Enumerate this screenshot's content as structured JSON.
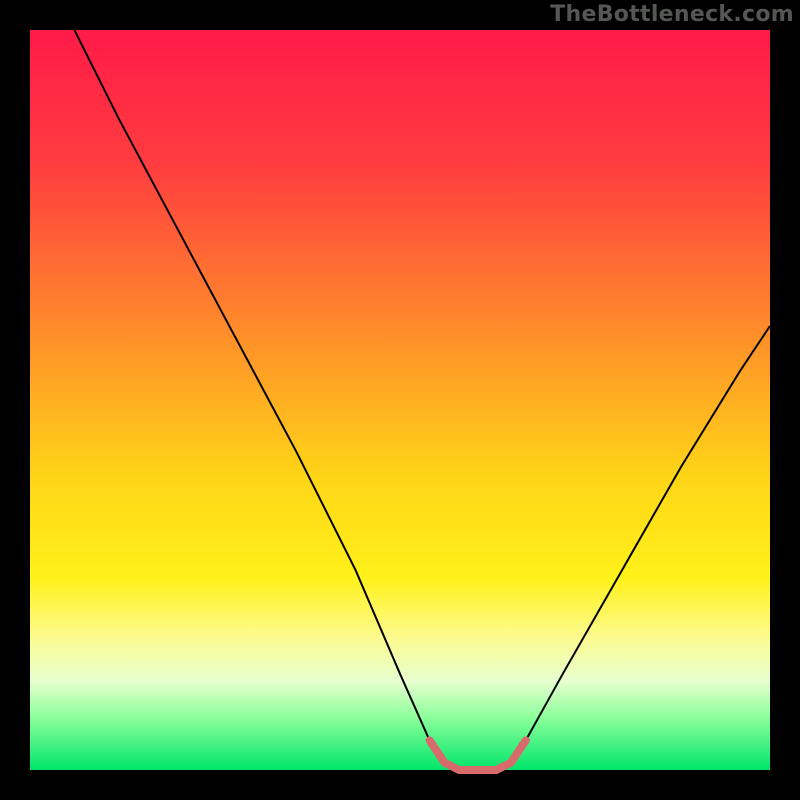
{
  "watermark": "TheBottleneck.com",
  "chart_data": {
    "type": "line",
    "title": "",
    "xlabel": "",
    "ylabel": "",
    "xlim": [
      0,
      100
    ],
    "ylim": [
      0,
      100
    ],
    "legend": false,
    "grid": false,
    "background_gradient_stops": [
      {
        "offset": 0,
        "color": "#ff1b48"
      },
      {
        "offset": 18,
        "color": "#ff3c3f"
      },
      {
        "offset": 40,
        "color": "#ff8a2b"
      },
      {
        "offset": 60,
        "color": "#ffd417"
      },
      {
        "offset": 74,
        "color": "#fff11a"
      },
      {
        "offset": 82,
        "color": "#fdfb8e"
      },
      {
        "offset": 88,
        "color": "#e7ffcf"
      },
      {
        "offset": 93,
        "color": "#8aff9a"
      },
      {
        "offset": 100,
        "color": "#00e56a"
      }
    ],
    "series": [
      {
        "name": "bottleneck-curve",
        "stroke": "#000000",
        "stroke_width": 2,
        "points": [
          {
            "x": 6,
            "y": 100
          },
          {
            "x": 12,
            "y": 88
          },
          {
            "x": 20,
            "y": 73
          },
          {
            "x": 28,
            "y": 58
          },
          {
            "x": 36,
            "y": 43
          },
          {
            "x": 44,
            "y": 27
          },
          {
            "x": 50,
            "y": 13
          },
          {
            "x": 54,
            "y": 4
          },
          {
            "x": 56,
            "y": 1
          },
          {
            "x": 58,
            "y": 0
          },
          {
            "x": 63,
            "y": 0
          },
          {
            "x": 65,
            "y": 1
          },
          {
            "x": 67,
            "y": 4
          },
          {
            "x": 72,
            "y": 13
          },
          {
            "x": 80,
            "y": 27
          },
          {
            "x": 88,
            "y": 41
          },
          {
            "x": 96,
            "y": 54
          },
          {
            "x": 100,
            "y": 60
          }
        ]
      },
      {
        "name": "optimal-zone-bracket",
        "stroke": "#d76b6b",
        "stroke_width": 8,
        "points": [
          {
            "x": 54,
            "y": 4
          },
          {
            "x": 56,
            "y": 1
          },
          {
            "x": 58,
            "y": 0
          },
          {
            "x": 63,
            "y": 0
          },
          {
            "x": 65,
            "y": 1
          },
          {
            "x": 67,
            "y": 4
          }
        ]
      }
    ]
  }
}
